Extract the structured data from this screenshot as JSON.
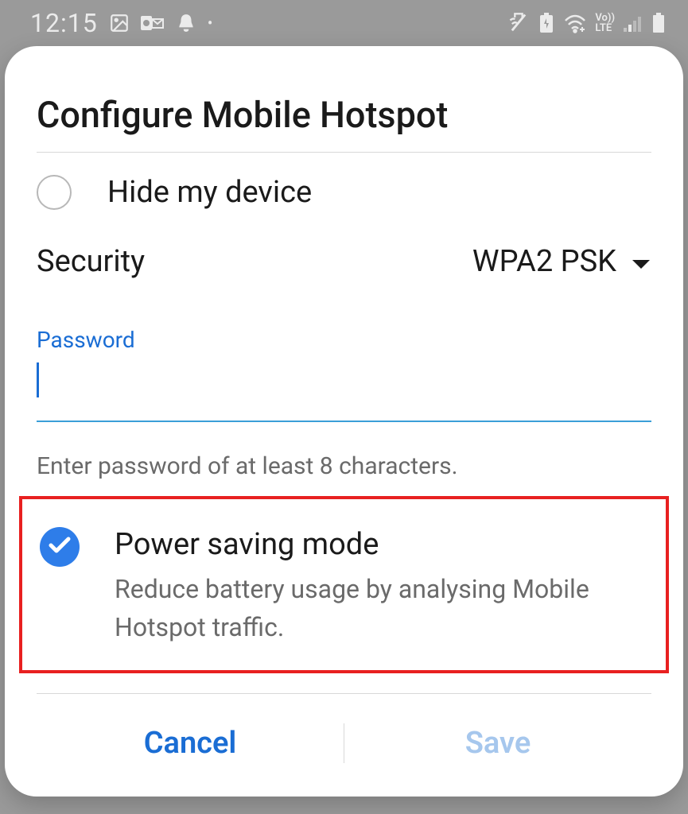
{
  "statusBar": {
    "time": "12:15"
  },
  "modal": {
    "title": "Configure Mobile Hotspot"
  },
  "hideDevice": {
    "label": "Hide my device",
    "checked": false
  },
  "security": {
    "label": "Security",
    "value": "WPA2 PSK"
  },
  "password": {
    "label": "Password",
    "value": "",
    "hint": "Enter password of at least 8 characters."
  },
  "powerSaving": {
    "title": "Power saving mode",
    "description": "Reduce battery usage by analysing Mobile Hotspot traffic.",
    "checked": true
  },
  "footer": {
    "cancel": "Cancel",
    "save": "Save"
  },
  "colors": {
    "accent": "#1a6dd4",
    "accentLight": "#a6c7ed",
    "highlight": "#e82020"
  }
}
